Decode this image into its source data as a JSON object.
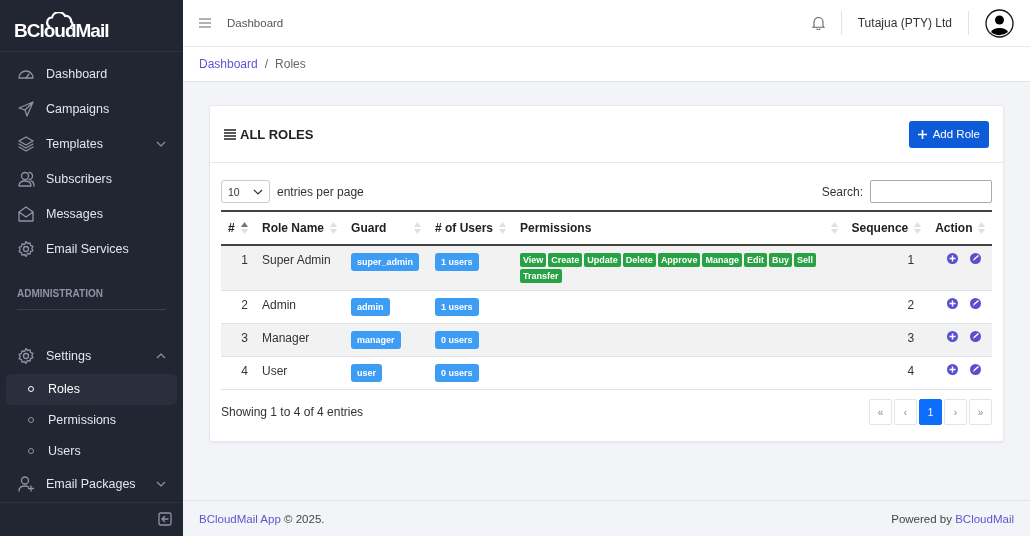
{
  "sidebar": {
    "logo": "BCloudMail",
    "sections": [
      {
        "items": [
          {
            "label": "Dashboard",
            "selected": false
          },
          {
            "label": "Campaigns",
            "selected": false
          },
          {
            "label": "Templates",
            "selected": false,
            "expanded": false
          },
          {
            "label": "Subscribers",
            "selected": false
          },
          {
            "label": "Messages",
            "selected": false
          },
          {
            "label": "Email Services",
            "selected": false
          }
        ]
      },
      {
        "heading": "ADMINISTRATION",
        "items": [
          {
            "label": "Settings",
            "selected": false,
            "expanded": true,
            "children": [
              {
                "label": "Roles",
                "selected": true
              },
              {
                "label": "Permissions",
                "selected": false
              },
              {
                "label": "Users",
                "selected": false
              }
            ]
          },
          {
            "label": "Email Packages",
            "selected": false,
            "expanded": false
          }
        ]
      }
    ]
  },
  "topbar": {
    "title": "Dashboard",
    "company": "Tutajua (PTY) Ltd"
  },
  "breadcrumb": {
    "separator": "/",
    "items": [
      {
        "label": "Dashboard",
        "link": true
      },
      {
        "label": "Roles",
        "link": false
      }
    ]
  },
  "card": {
    "title": "ALL ROLES",
    "add_button": "Add Role",
    "page_size": "10",
    "page_size_label": "entries per page",
    "search_label": "Search:",
    "columns": [
      {
        "label": "#",
        "sorted": true
      },
      {
        "label": "Role Name",
        "sorted": false
      },
      {
        "label": "Guard",
        "sorted": false
      },
      {
        "label": "# of Users",
        "sorted": false
      },
      {
        "label": "Permissions",
        "sorted": false
      },
      {
        "label": "Sequence",
        "sorted": false
      },
      {
        "label": "Action",
        "sorted": false
      }
    ],
    "rows": [
      {
        "number": "1",
        "name": "Super Admin",
        "guard": "super_admin",
        "users": "1 users",
        "permissions": [
          "View",
          "Create",
          "Update",
          "Delete",
          "Approve",
          "Manage",
          "Edit",
          "Buy",
          "Sell",
          "Transfer"
        ],
        "sequence": "1"
      },
      {
        "number": "2",
        "name": "Admin",
        "guard": "admin",
        "users": "1 users",
        "sequence": "2"
      },
      {
        "number": "3",
        "name": "Manager",
        "guard": "manager",
        "users": "0 users",
        "sequence": "3"
      },
      {
        "number": "4",
        "name": "User",
        "guard": "user",
        "users": "0 users",
        "sequence": "4"
      }
    ],
    "info": "Showing 1 to 4 of 4 entries",
    "pagination": [
      {
        "label": "«",
        "selected": false
      },
      {
        "label": "‹",
        "selected": false
      },
      {
        "label": "1",
        "selected": true
      },
      {
        "label": "›",
        "selected": false
      },
      {
        "label": "»",
        "selected": false
      }
    ]
  },
  "footer": {
    "app_link": "BCloudMail App",
    "copyright": "© 2025.",
    "powered": "Powered by",
    "powered_link": "BCloudMail"
  }
}
